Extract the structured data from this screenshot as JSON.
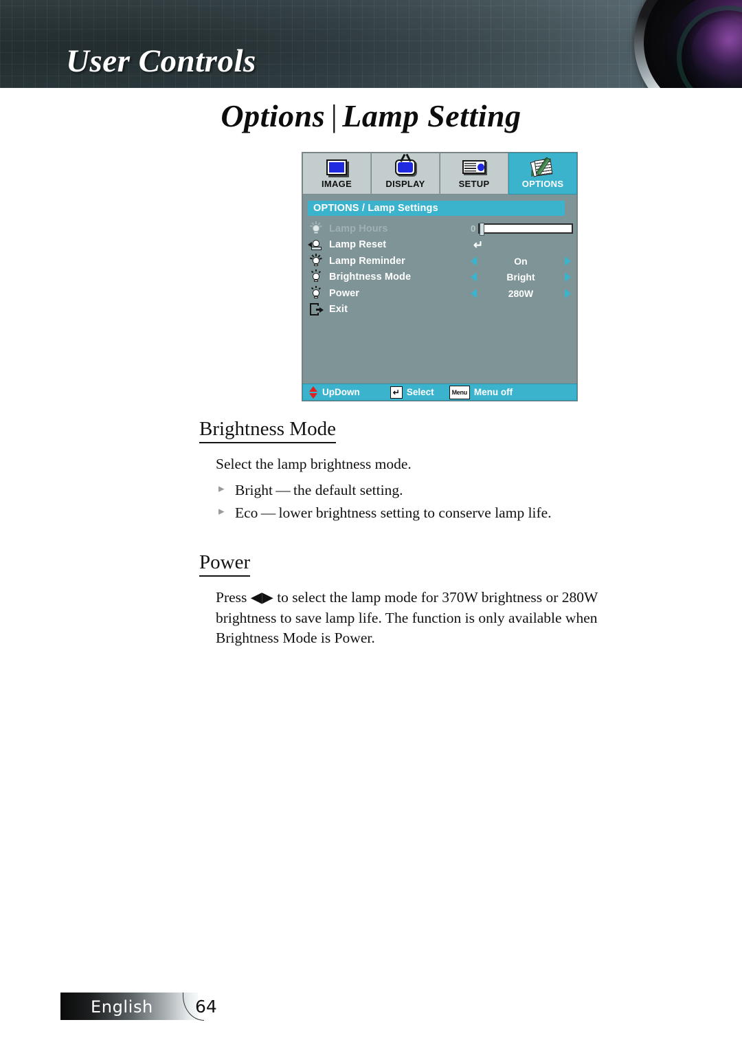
{
  "header": {
    "title": "User Controls"
  },
  "page_title": {
    "left": "Options",
    "divider": "|",
    "right": "Lamp Setting"
  },
  "osd": {
    "tabs": [
      {
        "label": "IMAGE",
        "icon": "image-icon",
        "active": false
      },
      {
        "label": "DISPLAY",
        "icon": "display-icon",
        "active": false
      },
      {
        "label": "SETUP",
        "icon": "setup-icon",
        "active": false
      },
      {
        "label": "OPTIONS",
        "icon": "options-icon",
        "active": true
      }
    ],
    "section_title": "OPTIONS / Lamp Settings",
    "rows": [
      {
        "label": "Lamp Hours",
        "icon": "lamp-hours-icon",
        "control": "slider",
        "value": "0"
      },
      {
        "label": "Lamp Reset",
        "icon": "lamp-reset-icon",
        "control": "enter",
        "value": "↵"
      },
      {
        "label": "Lamp Reminder",
        "icon": "lamp-reminder-icon",
        "control": "spinner",
        "value": "On"
      },
      {
        "label": "Brightness Mode",
        "icon": "brightness-mode-icon",
        "control": "spinner",
        "value": "Bright"
      },
      {
        "label": "Power",
        "icon": "power-icon",
        "control": "spinner",
        "value": "280W"
      },
      {
        "label": "Exit",
        "icon": "exit-icon",
        "control": "none",
        "value": ""
      }
    ],
    "footer": {
      "updown_label": "UpDown",
      "select_key": "↵",
      "select_label": "Select",
      "menu_key": "Menu",
      "menu_label": "Menu off"
    },
    "colors": {
      "accent": "#3cb3cd",
      "panel": "#7e9497",
      "tab": "#c3cdcd",
      "screen_blue": "#1f2ae0",
      "arrow_red": "#e02020"
    }
  },
  "content": {
    "sections": [
      {
        "heading": "Brightness Mode",
        "paragraph": "Select the lamp brightness mode.",
        "bullets": [
          "Bright — the default setting.",
          "Eco — lower brightness setting to conserve lamp life."
        ]
      },
      {
        "heading": "Power",
        "paragraph": "Press ◀▶ to select the lamp mode for 370W brightness or 280W brightness to save lamp life. The function is only available when Brightness Mode is Power.",
        "bullets": []
      }
    ]
  },
  "footer": {
    "language": "English",
    "page_number": "64"
  }
}
